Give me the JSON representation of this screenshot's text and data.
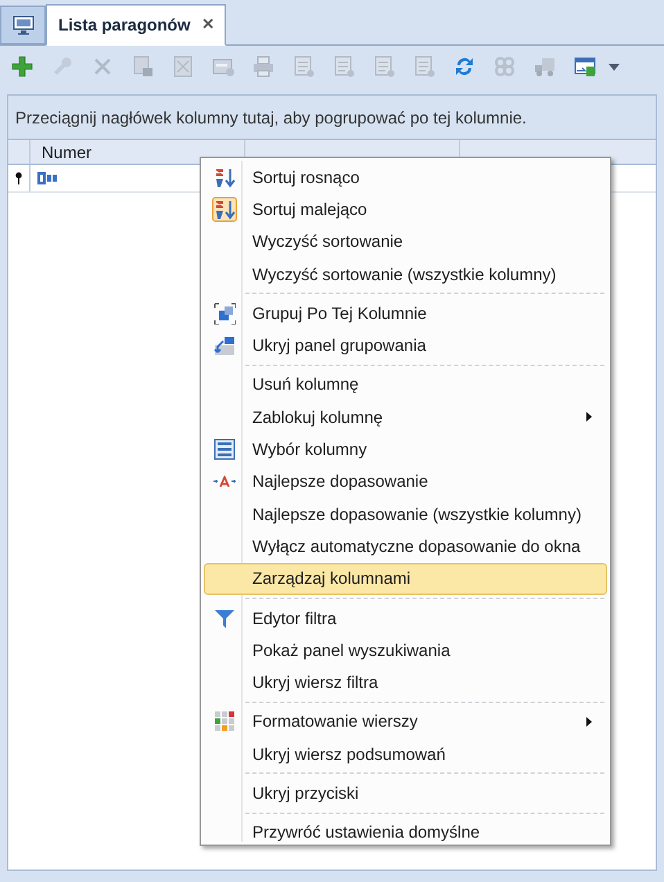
{
  "tabs": [
    {
      "kind": "home",
      "selected": false
    },
    {
      "kind": "document",
      "label": "Lista paragonów",
      "close": "✕",
      "selected": true
    }
  ],
  "toolbar": [
    {
      "kind": "add",
      "disabled": false
    },
    {
      "kind": "wrench",
      "disabled": true
    },
    {
      "kind": "delete",
      "disabled": true
    },
    {
      "kind": "save",
      "disabled": true
    },
    {
      "kind": "cancel",
      "disabled": true
    },
    {
      "kind": "card",
      "disabled": true
    },
    {
      "kind": "print",
      "disabled": true
    },
    {
      "kind": "doc",
      "disabled": true
    },
    {
      "kind": "doc",
      "disabled": true
    },
    {
      "kind": "doc",
      "disabled": true
    },
    {
      "kind": "doc",
      "disabled": true
    },
    {
      "kind": "refresh",
      "disabled": false
    },
    {
      "kind": "link",
      "disabled": true
    },
    {
      "kind": "truck",
      "disabled": true
    },
    {
      "kind": "export",
      "disabled": false
    }
  ],
  "group_panel": {
    "hint": "Przeciągnij nagłówek kolumny tutaj, aby pogrupować po tej kolumnie."
  },
  "grid": {
    "columns": [
      {
        "label": "Numer"
      }
    ]
  },
  "context_menu": {
    "items": [
      {
        "label": "Sortuj rosnąco",
        "kind": "sort-asc",
        "separator_before": false,
        "submenu": false,
        "selected": false
      },
      {
        "label": "Sortuj malejąco",
        "kind": "sort-desc",
        "separator_before": false,
        "submenu": false,
        "selected": false
      },
      {
        "label": "Wyczyść sortowanie",
        "kind": "plain",
        "separator_before": false,
        "submenu": false,
        "selected": false
      },
      {
        "label": "Wyczyść sortowanie (wszystkie kolumny)",
        "kind": "plain",
        "separator_before": false,
        "submenu": false,
        "selected": false
      },
      {
        "label": "Grupuj Po Tej Kolumnie",
        "kind": "group",
        "separator_before": true,
        "submenu": false,
        "selected": false
      },
      {
        "label": "Ukryj panel grupowania",
        "kind": "ungroup",
        "separator_before": false,
        "submenu": false,
        "selected": false
      },
      {
        "label": "Usuń kolumnę",
        "kind": "plain",
        "separator_before": true,
        "submenu": false,
        "selected": false
      },
      {
        "label": "Zablokuj kolumnę",
        "kind": "plain",
        "separator_before": false,
        "submenu": true,
        "selected": false
      },
      {
        "label": "Wybór kolumny",
        "kind": "columns",
        "separator_before": false,
        "submenu": false,
        "selected": false
      },
      {
        "label": "Najlepsze dopasowanie",
        "kind": "bestfit",
        "separator_before": false,
        "submenu": false,
        "selected": false
      },
      {
        "label": "Najlepsze dopasowanie (wszystkie kolumny)",
        "kind": "plain",
        "separator_before": false,
        "submenu": false,
        "selected": false
      },
      {
        "label": "Wyłącz automatyczne dopasowanie do okna",
        "kind": "plain",
        "separator_before": false,
        "submenu": false,
        "selected": false
      },
      {
        "label": "Zarządzaj kolumnami",
        "kind": "plain",
        "separator_before": false,
        "submenu": false,
        "selected": true
      },
      {
        "label": "Edytor filtra",
        "kind": "filter",
        "separator_before": true,
        "submenu": false,
        "selected": false
      },
      {
        "label": "Pokaż panel wyszukiwania",
        "kind": "plain",
        "separator_before": false,
        "submenu": false,
        "selected": false
      },
      {
        "label": "Ukryj wiersz filtra",
        "kind": "plain",
        "separator_before": false,
        "submenu": false,
        "selected": false
      },
      {
        "label": "Formatowanie wierszy",
        "kind": "format",
        "separator_before": true,
        "submenu": true,
        "selected": false
      },
      {
        "label": "Ukryj wiersz podsumowań",
        "kind": "plain",
        "separator_before": false,
        "submenu": false,
        "selected": false
      },
      {
        "label": "Ukryj przyciski",
        "kind": "plain",
        "separator_before": true,
        "submenu": false,
        "selected": false
      },
      {
        "label": "Przywróć ustawienia domyślne",
        "kind": "plain",
        "separator_before": true,
        "submenu": false,
        "selected": false
      }
    ]
  }
}
